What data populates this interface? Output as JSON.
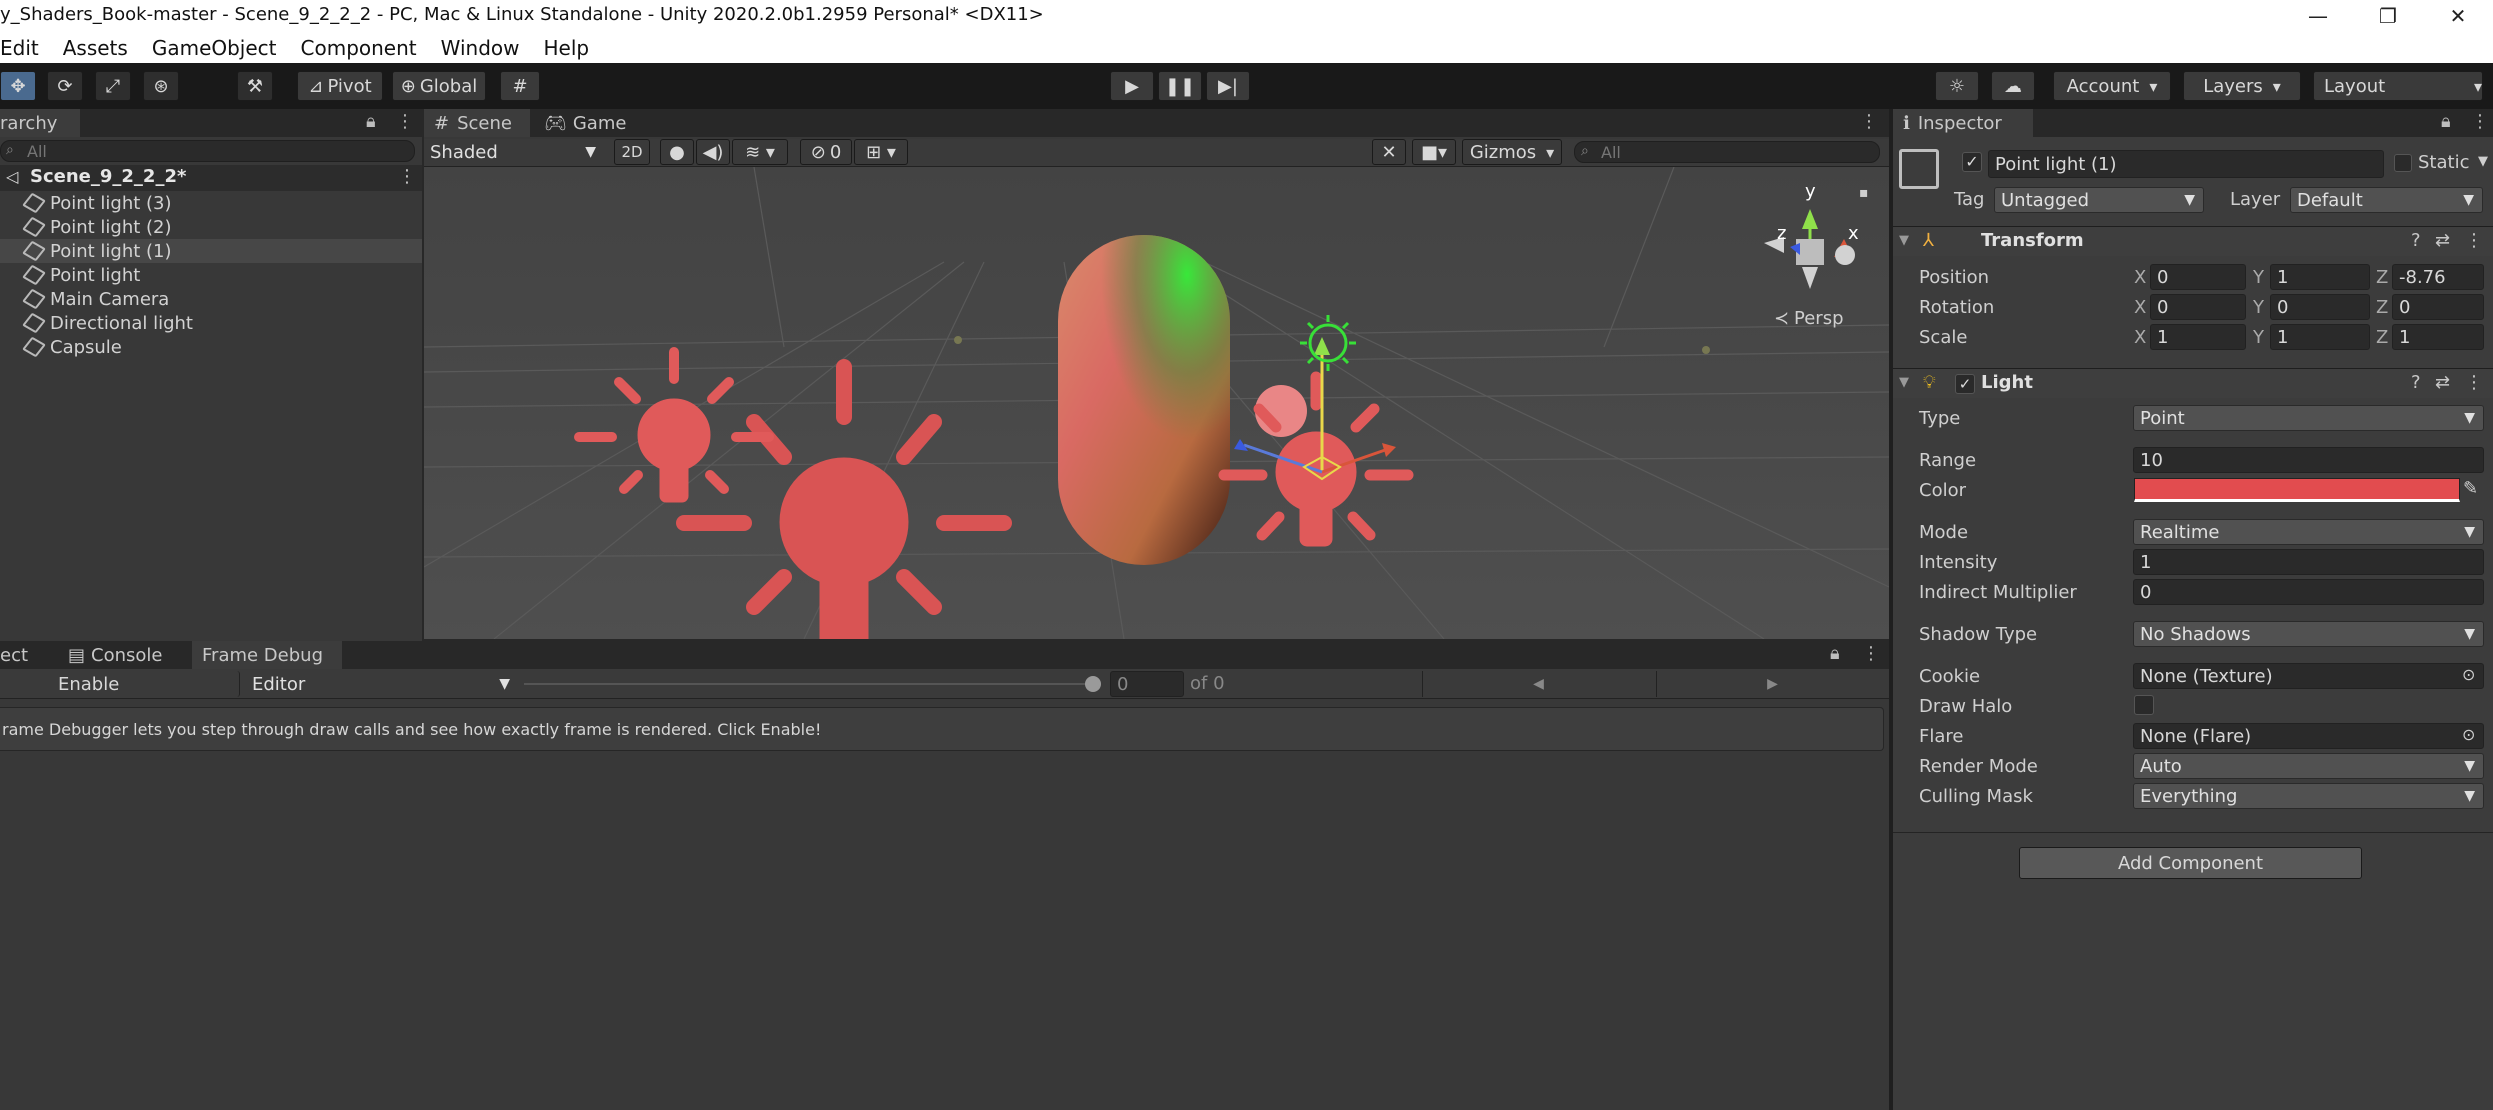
{
  "window": {
    "title": "y_Shaders_Book-master - Scene_9_2_2_2 - PC, Mac & Linux Standalone - Unity 2020.2.0b1.2959 Personal* <DX11>",
    "minimize": "—",
    "maximize": "❐",
    "close": "✕"
  },
  "menu": [
    "Edit",
    "Assets",
    "GameObject",
    "Component",
    "Window",
    "Help"
  ],
  "toolbar": {
    "pivot": "Pivot",
    "global": "Global",
    "account": "Account",
    "layers": "Layers",
    "layout": "Layout"
  },
  "hierarchy": {
    "tab": "rarchy",
    "search_placeholder": "All",
    "scene": "Scene_9_2_2_2*",
    "items": [
      "Point light (3)",
      "Point light (2)",
      "Point light (1)",
      "Point light",
      "Main Camera",
      "Directional light",
      "Capsule"
    ]
  },
  "scene_panel": {
    "tabs": [
      "Scene",
      "Game"
    ],
    "shading": "Shaded",
    "mode_2d": "2D",
    "hidden_count": "0",
    "gizmos": "Gizmos",
    "search_placeholder": "All",
    "persp": "Persp",
    "axis_y": "y",
    "axis_x": "x",
    "axis_z": "z"
  },
  "bottom_panel": {
    "tabs": [
      "ect",
      "Console",
      "Frame Debug"
    ],
    "enable": "Enable",
    "target": "Editor",
    "frame_value": "0",
    "of_label": "of 0",
    "message": "rame Debugger lets you step through draw calls and see how exactly frame is rendered. Click Enable!"
  },
  "inspector": {
    "tab": "Inspector",
    "object_name": "Point light (1)",
    "static_label": "Static",
    "tag_label": "Tag",
    "tag_value": "Untagged",
    "layer_label": "Layer",
    "layer_value": "Default",
    "transform": {
      "title": "Transform",
      "rows": [
        {
          "label": "Position",
          "x": "0",
          "y": "1",
          "z": "-8.76"
        },
        {
          "label": "Rotation",
          "x": "0",
          "y": "0",
          "z": "0"
        },
        {
          "label": "Scale",
          "x": "1",
          "y": "1",
          "z": "1"
        }
      ],
      "x_label": "X",
      "y_label": "Y",
      "z_label": "Z"
    },
    "light": {
      "title": "Light",
      "type_label": "Type",
      "type_value": "Point",
      "range_label": "Range",
      "range_value": "10",
      "color_label": "Color",
      "color_value": "#e24c4f",
      "mode_label": "Mode",
      "mode_value": "Realtime",
      "intensity_label": "Intensity",
      "intensity_value": "1",
      "indirect_label": "Indirect Multiplier",
      "indirect_value": "0",
      "shadow_label": "Shadow Type",
      "shadow_value": "No Shadows",
      "cookie_label": "Cookie",
      "cookie_value": "None (Texture)",
      "halo_label": "Draw Halo",
      "flare_label": "Flare",
      "flare_value": "None (Flare)",
      "render_label": "Render Mode",
      "render_value": "Auto",
      "culling_label": "Culling Mask",
      "culling_value": "Everything"
    },
    "add_component": "Add Component"
  }
}
